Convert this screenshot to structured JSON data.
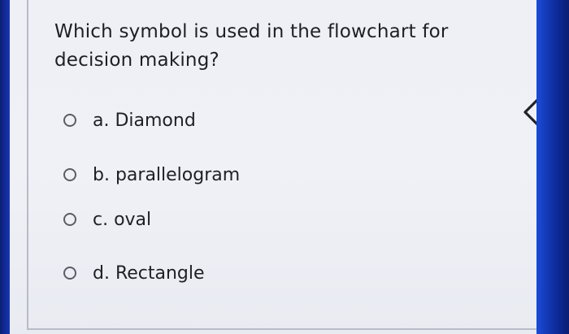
{
  "question": {
    "line1": "Which symbol is used in the flowchart for",
    "line2": "decision making?"
  },
  "options": [
    {
      "label": "a. Diamond"
    },
    {
      "label": "b. parallelogram"
    },
    {
      "label": "c. oval"
    },
    {
      "label": "d. Rectangle"
    }
  ],
  "icons": {
    "collapse": "chevron-left-icon",
    "radio": "radio-unchecked-icon"
  },
  "colors": {
    "background": "#eef0f6",
    "text": "#1e1f24",
    "radio_border": "#5a5d66",
    "device_frame": "#1a4bd6"
  }
}
